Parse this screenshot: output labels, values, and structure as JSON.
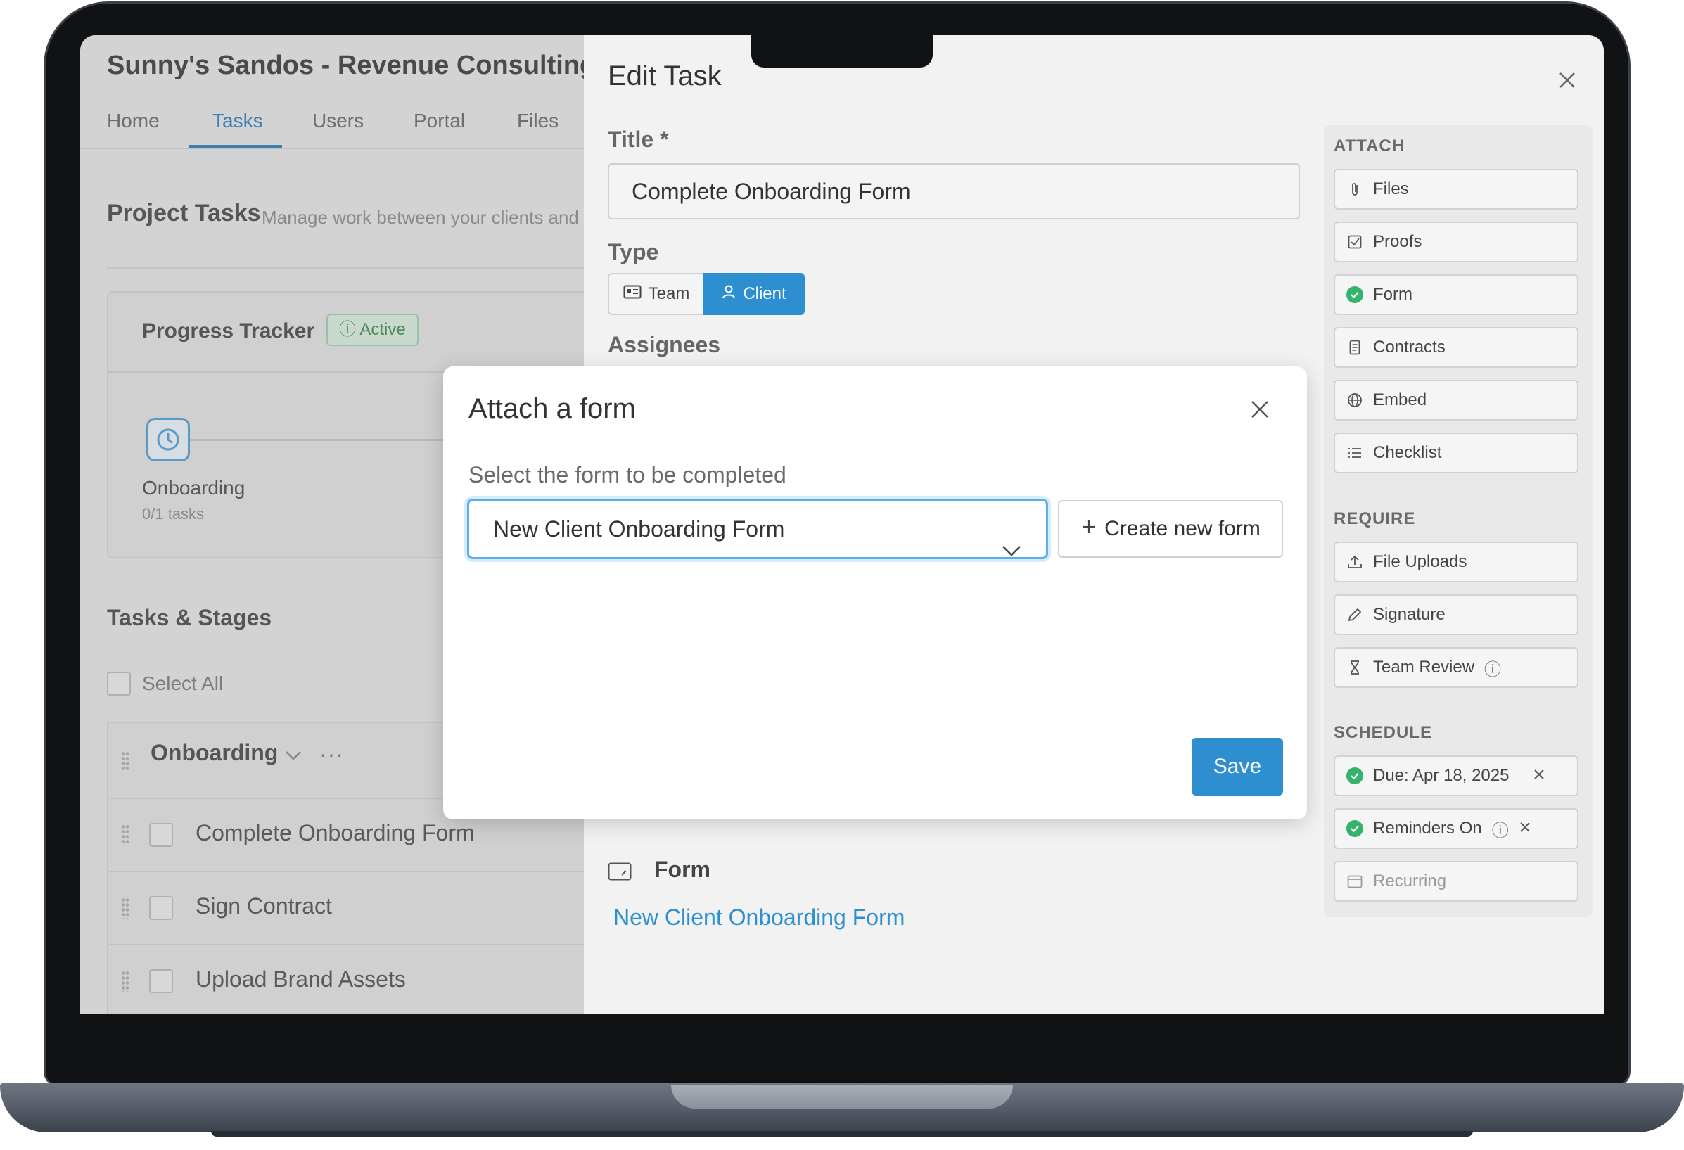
{
  "app": {
    "title": "Sunny's Sandos - Revenue Consulting",
    "nav": [
      "Home",
      "Tasks",
      "Users",
      "Portal",
      "Files"
    ],
    "active_nav": "Tasks",
    "section_title": "Project Tasks",
    "section_subtitle": "Manage work between your clients and your team",
    "progress": {
      "title": "Progress Tracker",
      "badge": "Active",
      "stage_name": "Onboarding",
      "stage_count": "0/1 tasks"
    },
    "tasks_title": "Tasks & Stages",
    "select_all": "Select All",
    "group_label": "Onboarding",
    "tasks": [
      "Complete Onboarding Form",
      "Sign Contract",
      "Upload Brand Assets"
    ]
  },
  "panel": {
    "title": "Edit Task",
    "title_label": "Title *",
    "title_value": "Complete Onboarding Form",
    "type_label": "Type",
    "type_team": "Team",
    "type_client": "Client",
    "assignees_label": "Assignees",
    "form_card_title": "Form",
    "form_link": "New Client Onboarding Form"
  },
  "side": {
    "attach_heading": "ATTACH",
    "attach": [
      "Files",
      "Proofs",
      "Form",
      "Contracts",
      "Embed",
      "Checklist"
    ],
    "require_heading": "REQUIRE",
    "require": [
      "File Uploads",
      "Signature",
      "Team Review"
    ],
    "schedule_heading": "SCHEDULE",
    "schedule": [
      "Due: Apr 18, 2025",
      "Reminders On",
      "Recurring"
    ]
  },
  "modal": {
    "title": "Attach a form",
    "label": "Select the form to be completed",
    "selected_form": "New Client Onboarding Form",
    "create_label": "Create new form",
    "save_label": "Save"
  },
  "colors": {
    "accent": "#2d8fd0",
    "success": "#35b26b"
  }
}
